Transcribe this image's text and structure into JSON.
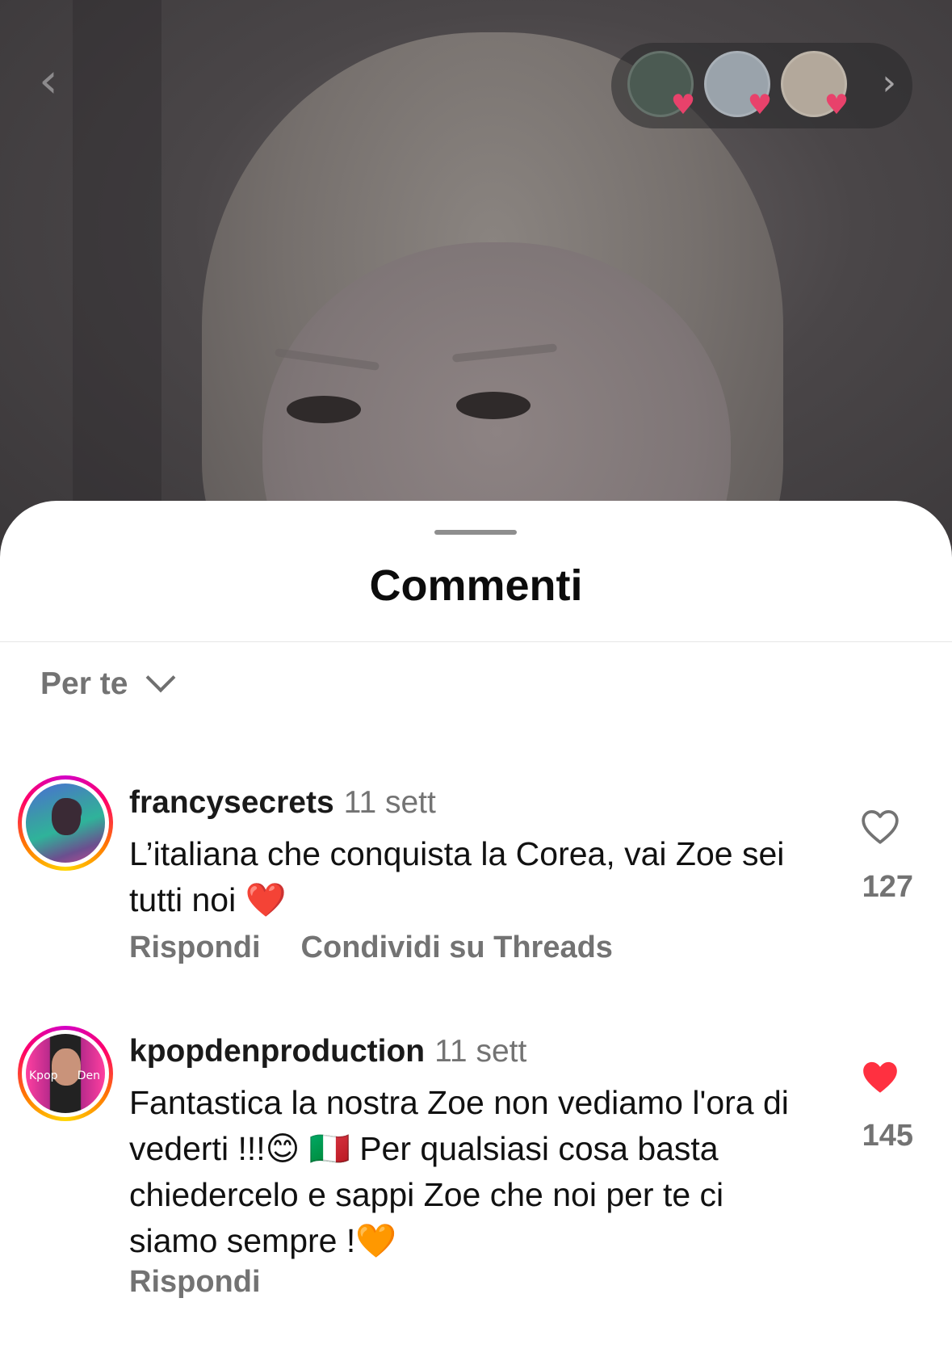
{
  "header": {
    "back_glyph": "‹",
    "likers": [
      {
        "name": "liker-1",
        "color": "#4b5a52"
      },
      {
        "name": "liker-2",
        "color": "#9aa3ab"
      },
      {
        "name": "liker-3",
        "color": "#b3a89b"
      }
    ],
    "heart_glyph": "♥",
    "next_glyph": "›"
  },
  "sheet": {
    "title": "Commenti",
    "sort_label": "Per te"
  },
  "comments": [
    {
      "username": "francysecrets",
      "time": "11 sett",
      "text": "L’italiana che conquista la Corea, vai Zoe sei tutti noi ❤️",
      "liked": false,
      "like_count": "127",
      "actions": [
        "Rispondi",
        "Condividi su Threads"
      ]
    },
    {
      "username": "kpopdenproduction",
      "time": "11 sett",
      "text": "Fantastica la nostra Zoe non vediamo l'ora di vederti !!!😊 🇮🇹 Per qualsiasi cosa basta chiedercelo e sappi Zoe che noi per te ci siamo sempre !🧡",
      "liked": true,
      "like_count": "145",
      "avatar_labels": [
        "Kpop",
        "Den"
      ],
      "actions": [
        "Rispondi"
      ]
    }
  ],
  "colors": {
    "like_active": "#ff3040",
    "secondary_text": "#737373"
  }
}
